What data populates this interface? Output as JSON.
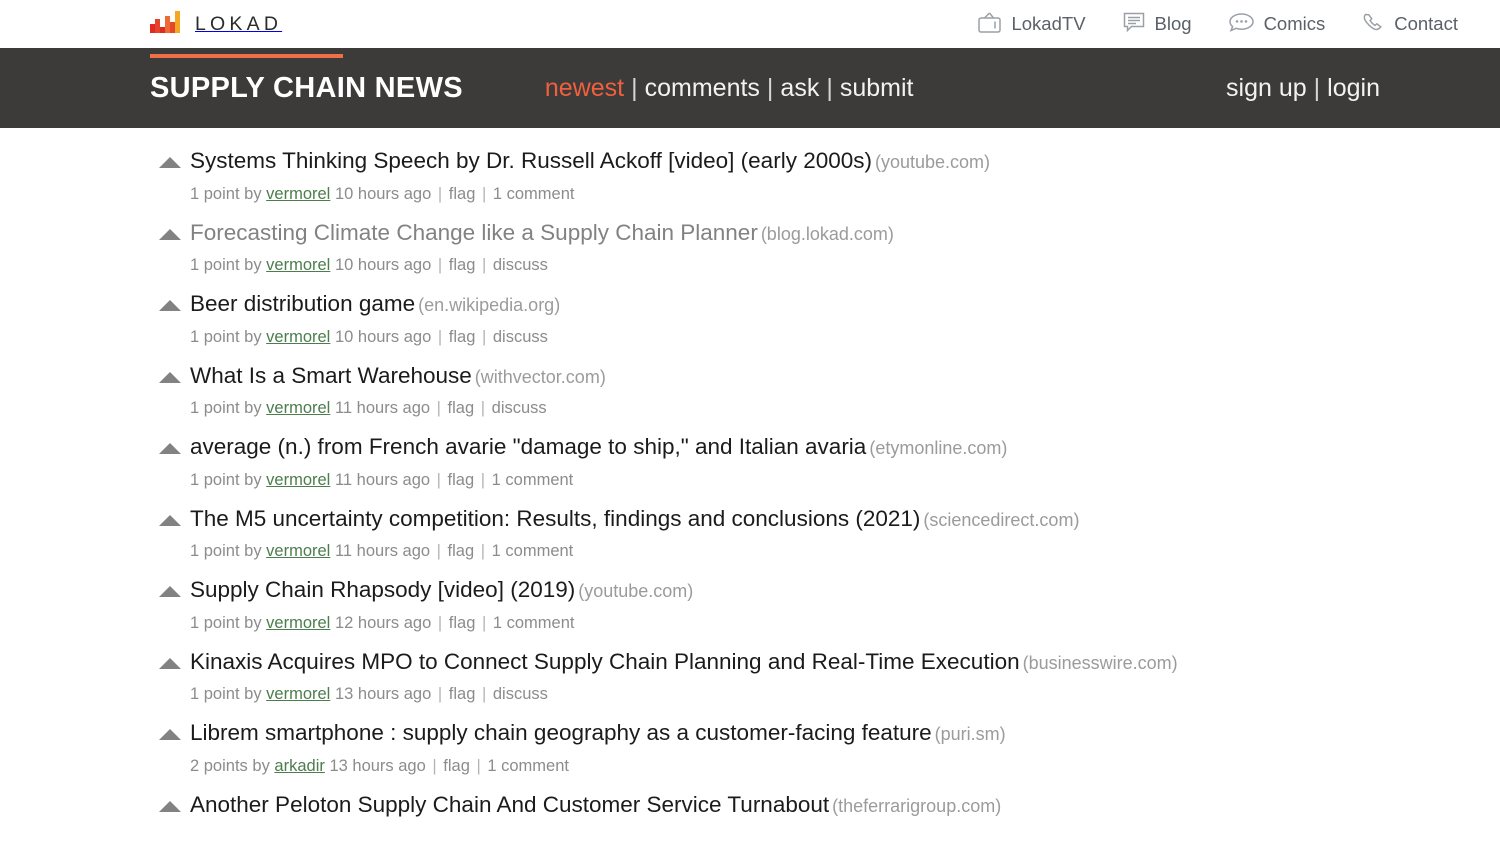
{
  "topbar": {
    "brand": {
      "wordmark": "LOKAD",
      "mark_icon": "lokad-bars-logo"
    },
    "nav": [
      {
        "label": "LokadTV",
        "icon": "tv-icon"
      },
      {
        "label": "Blog",
        "icon": "document-lines-icon"
      },
      {
        "label": "Comics",
        "icon": "speech-bubble-icon"
      },
      {
        "label": "Contact",
        "icon": "phone-icon"
      }
    ]
  },
  "header": {
    "title": "SUPPLY CHAIN NEWS",
    "accent_color": "#ef7048",
    "background_color": "#3c3b39",
    "nav": [
      {
        "label": "newest",
        "active": true
      },
      {
        "label": "comments",
        "active": false
      },
      {
        "label": "ask",
        "active": false
      },
      {
        "label": "submit",
        "active": false
      }
    ],
    "separator": "|",
    "auth": [
      {
        "label": "sign up"
      },
      {
        "label": "login"
      }
    ]
  },
  "stories": [
    {
      "title": "Systems Thinking Speech by Dr. Russell Ackoff [video] (early 2000s)",
      "domain": "(youtube.com)",
      "visited": false,
      "points": "1 point",
      "by": "by",
      "user": "vermorel",
      "age": "10 hours ago",
      "flag": "flag",
      "comments": "1 comment"
    },
    {
      "title": "Forecasting Climate Change like a Supply Chain Planner",
      "domain": "(blog.lokad.com)",
      "visited": true,
      "points": "1 point",
      "by": "by",
      "user": "vermorel",
      "age": "10 hours ago",
      "flag": "flag",
      "comments": "discuss"
    },
    {
      "title": "Beer distribution game",
      "domain": "(en.wikipedia.org)",
      "visited": false,
      "points": "1 point",
      "by": "by",
      "user": "vermorel",
      "age": "10 hours ago",
      "flag": "flag",
      "comments": "discuss"
    },
    {
      "title": "What Is a Smart Warehouse",
      "domain": "(withvector.com)",
      "visited": false,
      "points": "1 point",
      "by": "by",
      "user": "vermorel",
      "age": "11 hours ago",
      "flag": "flag",
      "comments": "discuss"
    },
    {
      "title": "average (n.) from French avarie \"damage to ship,\" and Italian avaria",
      "domain": "(etymonline.com)",
      "visited": false,
      "points": "1 point",
      "by": "by",
      "user": "vermorel",
      "age": "11 hours ago",
      "flag": "flag",
      "comments": "1 comment"
    },
    {
      "title": "The M5 uncertainty competition: Results, findings and conclusions (2021)",
      "domain": "(sciencedirect.com)",
      "visited": false,
      "points": "1 point",
      "by": "by",
      "user": "vermorel",
      "age": "11 hours ago",
      "flag": "flag",
      "comments": "1 comment"
    },
    {
      "title": "Supply Chain Rhapsody [video] (2019)",
      "domain": "(youtube.com)",
      "visited": false,
      "points": "1 point",
      "by": "by",
      "user": "vermorel",
      "age": "12 hours ago",
      "flag": "flag",
      "comments": "1 comment"
    },
    {
      "title": "Kinaxis Acquires MPO to Connect Supply Chain Planning and Real-Time Execution",
      "domain": "(businesswire.com)",
      "visited": false,
      "points": "1 point",
      "by": "by",
      "user": "vermorel",
      "age": "13 hours ago",
      "flag": "flag",
      "comments": "discuss"
    },
    {
      "title": "Librem smartphone : supply chain geography as a customer-facing feature",
      "domain": "(puri.sm)",
      "visited": false,
      "points": "2 points",
      "by": "by",
      "user": "arkadir",
      "age": "13 hours ago",
      "flag": "flag",
      "comments": "1 comment"
    },
    {
      "title": "Another Peloton Supply Chain And Customer Service Turnabout",
      "domain": "(theferrarigroup.com)",
      "visited": false,
      "points": "",
      "by": "",
      "user": "",
      "age": "",
      "flag": "",
      "comments": ""
    }
  ]
}
